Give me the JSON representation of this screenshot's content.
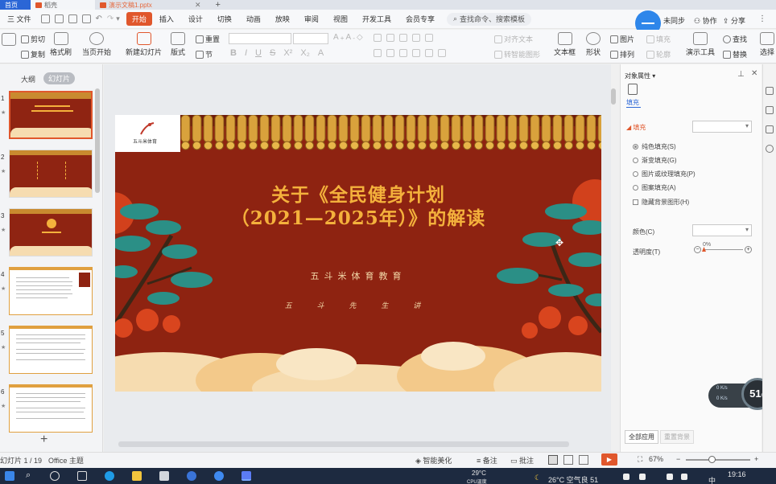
{
  "titlebar": {
    "home_tab": "首页",
    "doc_tab": "稻壳",
    "file_tab": "演示文稿1.pptx"
  },
  "menubar": {
    "file": "三 文件",
    "items": [
      "开始",
      "插入",
      "设计",
      "切换",
      "动画",
      "放映",
      "审阅",
      "视图",
      "开发工具",
      "会员专享"
    ],
    "search": "查找命令、搜索模板",
    "right": [
      "未同步",
      "协作",
      "分享"
    ]
  },
  "ribbon": {
    "cut": "剪切",
    "copy": "复制",
    "format_painter": "格式刷",
    "from_start": "当页开始",
    "new_slide": "新建幻灯片",
    "layout": "版式",
    "section": "节",
    "reset": "重置",
    "align_text": "对齐文本",
    "convert_art": "转智能图形",
    "textbox": "文本框",
    "shape": "形状",
    "arrange": "排列",
    "picture": "图片",
    "fill": "填充",
    "outline": "轮廓",
    "presentation_tools": "演示工具",
    "find": "查找",
    "replace": "替换",
    "select": "选择"
  },
  "left_panel": {
    "outline_tab": "大纲",
    "slides_tab": "幻灯片",
    "slide_numbers": [
      "1",
      "2",
      "3",
      "4",
      "5",
      "6"
    ],
    "add": "+"
  },
  "slide": {
    "logo_text": "五斗米体育",
    "title_line1": "关于《全民健身计划",
    "title_line2": "（2021—2025年）》的解读",
    "subtitle": "五斗米体育教育",
    "presenter": "五 斗 先 生 讲"
  },
  "right_panel": {
    "title": "对象属性 ▾",
    "tab_fill": "填充",
    "fill_header": "◢ 填充",
    "radios": [
      "纯色填充(S)",
      "渐变填充(G)",
      "图片或纹理填充(P)",
      "图案填充(A)"
    ],
    "hide_bg": "隐藏背景图形(H)",
    "color_label": "颜色(C)",
    "transparency_label": "透明度(T)",
    "transparency_value": "0%",
    "apply_all": "全部应用",
    "reset_bg": "重置背景"
  },
  "net_widget": {
    "percent": "51",
    "percent_unit": "%",
    "up": "0 K/s",
    "down": "0 K/s"
  },
  "statusbar": {
    "slide_counter": "幻灯片 1 / 19",
    "theme": "Office 主题",
    "smart_beautify": "智能美化",
    "notes": "备注",
    "comments": "批注",
    "zoom": "67%"
  },
  "taskbar": {
    "weather1_temp": "29°C",
    "weather1_desc": "CPU温度",
    "weather2": "26°C  空气良 51",
    "time": "19:16",
    "ime": "中"
  },
  "colors": {
    "accent": "#e0572c",
    "slide_bg": "#8e2311",
    "title_gold": "#f4b13c",
    "taskbar": "#1d2a40"
  }
}
